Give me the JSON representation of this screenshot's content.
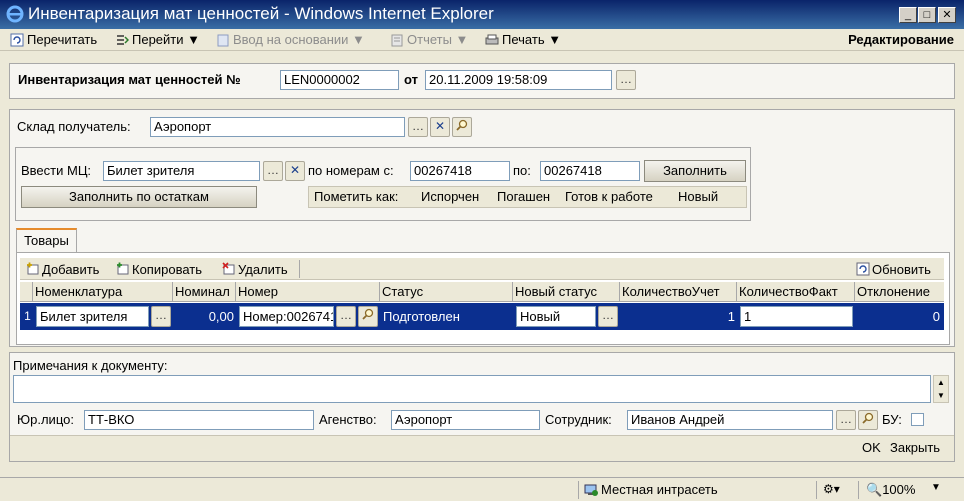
{
  "window": {
    "title": "Инвентаризация мат ценностей - Windows Internet Explorer"
  },
  "toolbar": {
    "reread": "Перечитать",
    "goto": "Перейти ▼",
    "enter_based": "Ввод на основании ▼",
    "reports": "Отчеты ▼",
    "print": "Печать ▼",
    "mode": "Редактирование"
  },
  "header": {
    "doc_label": "Инвентаризация мат ценностей №",
    "doc_number": "LEN0000002",
    "date_label": "от",
    "date_value": "20.11.2009 19:58:09"
  },
  "warehouse": {
    "label": "Склад получатель:",
    "value": "Аэропорт"
  },
  "enter": {
    "mc_label": "Ввести МЦ:",
    "mc_value": "Билет зрителя",
    "from_label": "по номерам с:",
    "from_value": "00267418",
    "to_label": "по:",
    "to_value": "00267418",
    "fill_button": "Заполнить",
    "fill_by_rest_button": "Заполнить по остаткам",
    "mark_label": "Пометить как:",
    "marks": [
      "Испорчен",
      "Погашен",
      "Готов к работе",
      "Новый"
    ]
  },
  "tabs": {
    "goods": "Товары"
  },
  "grid_toolbar": {
    "add": "Добавить",
    "copy": "Копировать",
    "delete": "Удалить",
    "refresh": "Обновить"
  },
  "grid": {
    "columns": [
      "Номенклатура",
      "Номинал",
      "Номер",
      "Статус",
      "Новый статус",
      "КоличествоУчет",
      "КоличествоФакт",
      "Отклонение"
    ],
    "rows": [
      {
        "index": "1",
        "nomenclature": "Билет зрителя",
        "nominal": "0,00",
        "number": "Номер:00267418",
        "status": "Подготовлен",
        "new_status": "Новый",
        "qty_account": "1",
        "qty_fact": "1",
        "deviation": "0"
      }
    ]
  },
  "footer": {
    "notes_label": "Примечания к документу:",
    "notes_value": "",
    "legal_label": "Юр.лицо:",
    "legal_value": "ТТ-ВКО",
    "agency_label": "Агенство:",
    "agency_value": "Аэропорт",
    "employee_label": "Сотрудник:",
    "employee_value": "Иванов Андрей",
    "bu_label": "БУ:",
    "ok": "OK",
    "close": "Закрыть"
  },
  "statusbar": {
    "zone": "Местная интрасеть",
    "zoom": "100%"
  },
  "colors": {
    "title_start": "#0a246a",
    "title_end": "#3a6ea5",
    "row_selected": "#0b2f8f",
    "tab_accent": "#e68b2c"
  }
}
